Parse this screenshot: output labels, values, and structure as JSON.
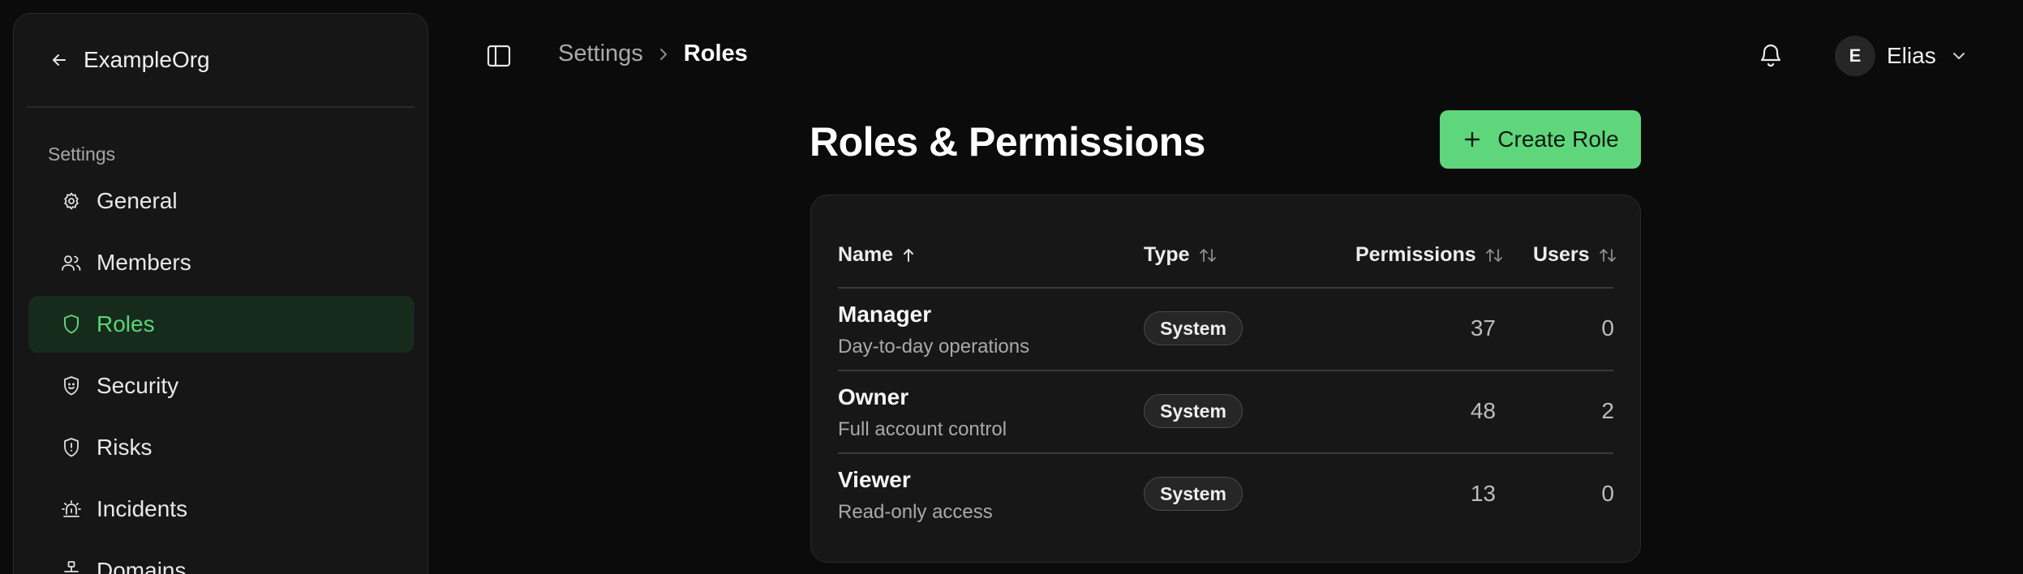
{
  "sidebar": {
    "org_name": "ExampleOrg",
    "section_label": "Settings",
    "items": [
      {
        "label": "General",
        "icon": "gear-icon"
      },
      {
        "label": "Members",
        "icon": "users-icon"
      },
      {
        "label": "Roles",
        "icon": "shield-icon",
        "active": true
      },
      {
        "label": "Security",
        "icon": "shield-face-icon"
      },
      {
        "label": "Risks",
        "icon": "shield-alert-icon"
      },
      {
        "label": "Incidents",
        "icon": "siren-icon"
      },
      {
        "label": "Domains",
        "icon": "network-icon"
      }
    ]
  },
  "topbar": {
    "breadcrumb": [
      "Settings",
      "Roles"
    ],
    "user_initial": "E",
    "user_name": "Elias"
  },
  "main": {
    "title": "Roles & Permissions",
    "create_label": "Create Role",
    "table": {
      "columns": [
        "Name",
        "Type",
        "Permissions",
        "Users"
      ],
      "rows": [
        {
          "name": "Manager",
          "description": "Day-to-day operations",
          "type": "System",
          "permissions": "37",
          "users": "0"
        },
        {
          "name": "Owner",
          "description": "Full account control",
          "type": "System",
          "permissions": "48",
          "users": "2"
        },
        {
          "name": "Viewer",
          "description": "Read-only access",
          "type": "System",
          "permissions": "13",
          "users": "0"
        }
      ]
    }
  },
  "colors": {
    "accent": "#5fd67b",
    "active_bg": "#172b1c",
    "active_text": "#5ad477",
    "background": "#0b0b0b",
    "card": "#171717"
  }
}
